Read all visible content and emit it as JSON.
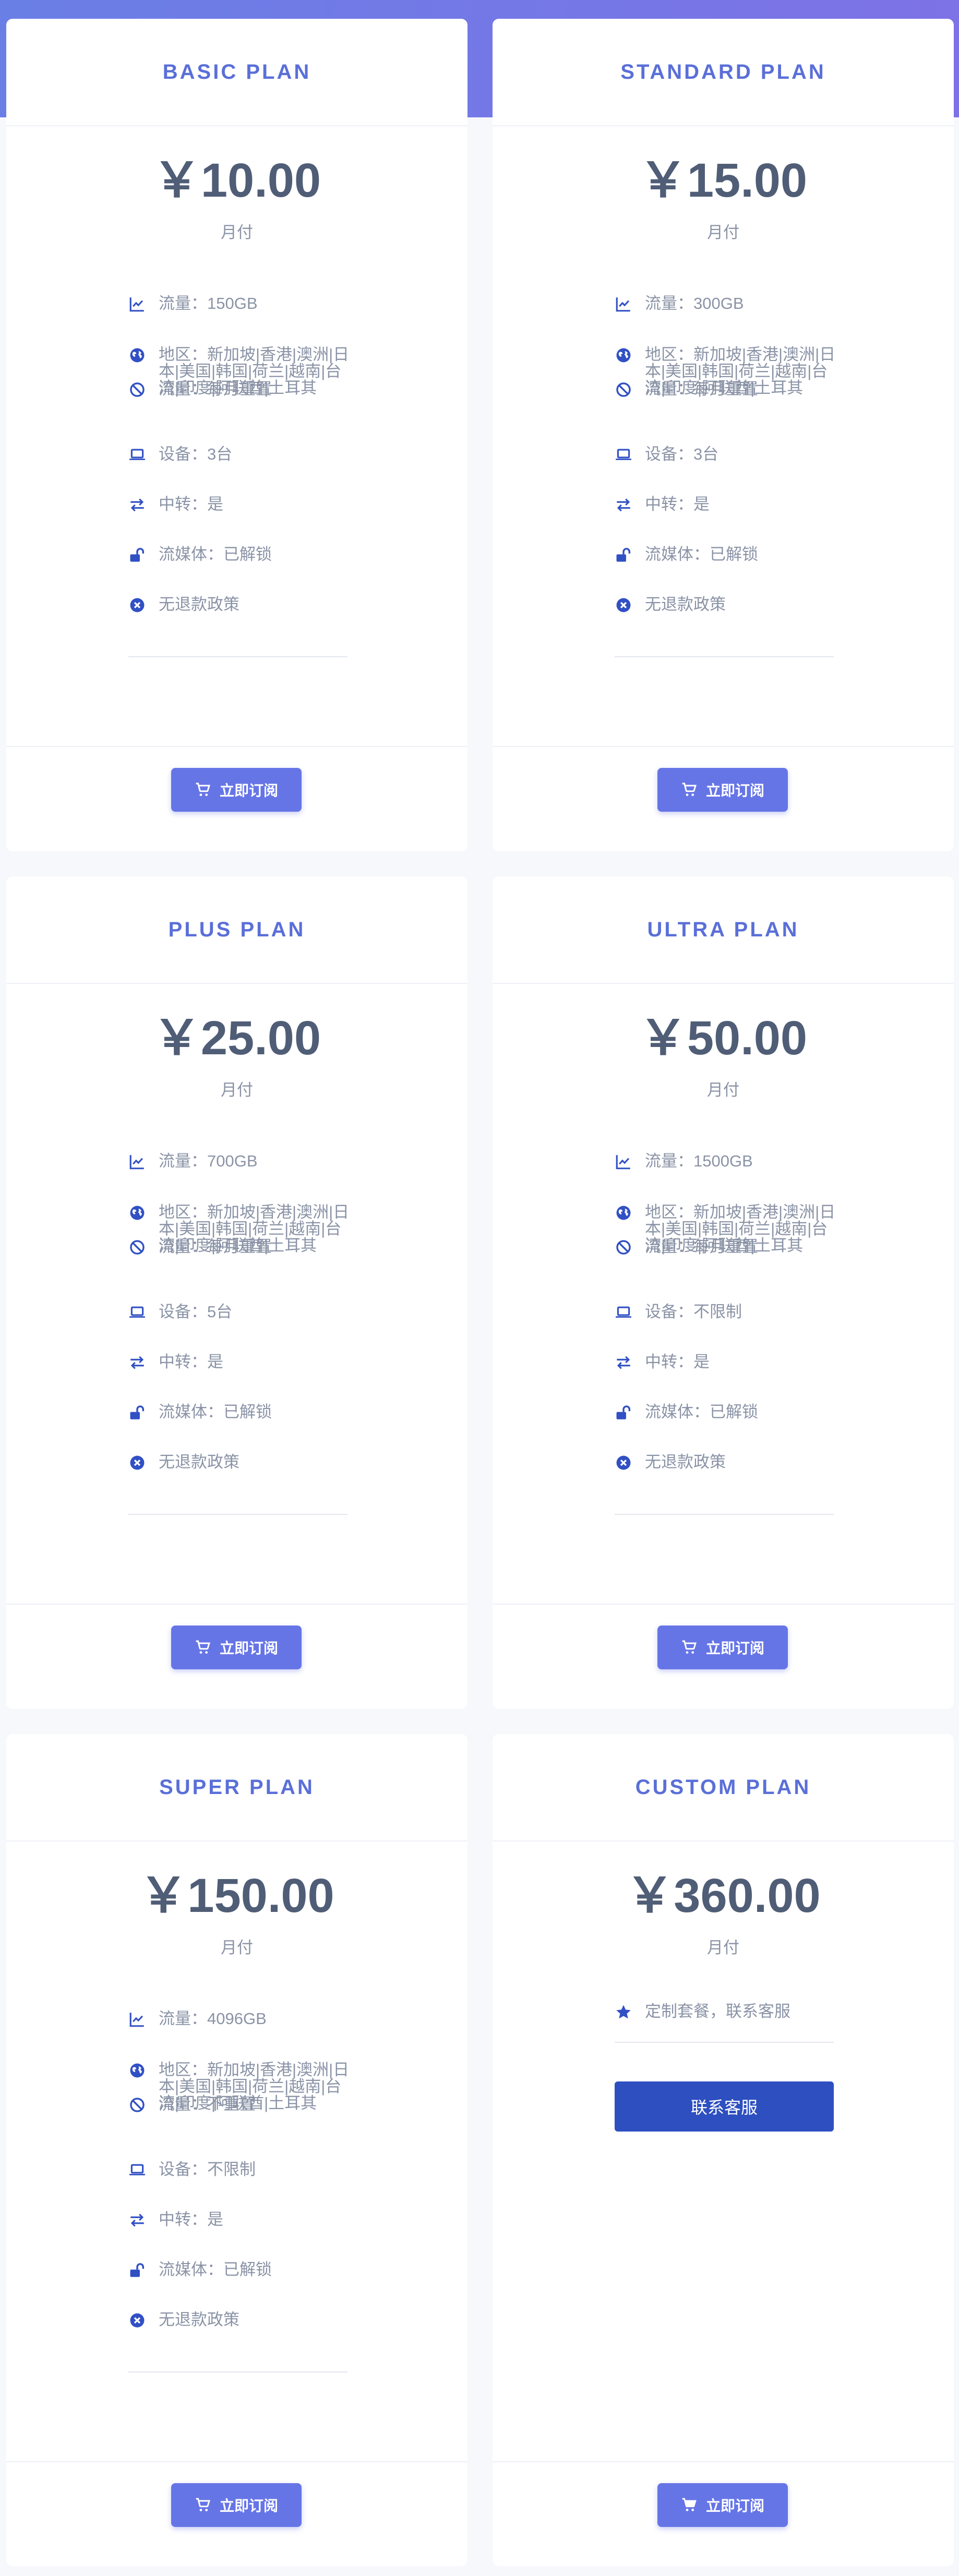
{
  "theme": {
    "accent": "#5a6fd8",
    "button": "#6675e6",
    "icon": "#3150c4",
    "contact_button": "#2d4fc0"
  },
  "plans": [
    {
      "name": "BASIC PLAN",
      "price": "￥10.00",
      "period": "月付",
      "features": {
        "traffic": "流量：150GB",
        "region": "地区：新加坡|香港|澳洲|日本|美国|韩国|荷兰|越南|台湾|印度|阿联酋|土耳其",
        "reset": "流量：每月重置",
        "devices": "设备：3台",
        "relay": "中转：是",
        "streaming": "流媒体：已解锁",
        "refund": "无退款政策"
      },
      "button": "立即订阅"
    },
    {
      "name": "STANDARD PLAN",
      "price": "￥15.00",
      "period": "月付",
      "features": {
        "traffic": "流量：300GB",
        "region": "地区：新加坡|香港|澳洲|日本|美国|韩国|荷兰|越南|台湾|印度|阿联酋|土耳其",
        "reset": "流量：每月重置",
        "devices": "设备：3台",
        "relay": "中转：是",
        "streaming": "流媒体：已解锁",
        "refund": "无退款政策"
      },
      "button": "立即订阅"
    },
    {
      "name": "PLUS PLAN",
      "price": "￥25.00",
      "period": "月付",
      "features": {
        "traffic": "流量：700GB",
        "region": "地区：新加坡|香港|澳洲|日本|美国|韩国|荷兰|越南|台湾|印度|阿联酋|土耳其",
        "reset": "流量：每月重置",
        "devices": "设备：5台",
        "relay": "中转：是",
        "streaming": "流媒体：已解锁",
        "refund": "无退款政策"
      },
      "button": "立即订阅"
    },
    {
      "name": "ULTRA PLAN",
      "price": "￥50.00",
      "period": "月付",
      "features": {
        "traffic": "流量：1500GB",
        "region": "地区：新加坡|香港|澳洲|日本|美国|韩国|荷兰|越南|台湾|印度|阿联酋|土耳其",
        "reset": "流量：每月重置",
        "devices": "设备：不限制",
        "relay": "中转：是",
        "streaming": "流媒体：已解锁",
        "refund": "无退款政策"
      },
      "button": "立即订阅"
    },
    {
      "name": "SUPER PLAN",
      "price": "￥150.00",
      "period": "月付",
      "features": {
        "traffic": "流量：4096GB",
        "region": "地区：新加坡|香港|澳洲|日本|美国|韩国|荷兰|越南|台湾|印度|阿联酋|土耳其",
        "reset": "流量：不重置",
        "devices": "设备：不限制",
        "relay": "中转：是",
        "streaming": "流媒体：已解锁",
        "refund": "无退款政策"
      },
      "button": "立即订阅"
    },
    {
      "name": "CUSTOM PLAN",
      "price": "￥360.00",
      "period": "月付",
      "custom_feature": "定制套餐，联系客服",
      "contact_button": "联系客服",
      "button": "立即订阅"
    }
  ]
}
